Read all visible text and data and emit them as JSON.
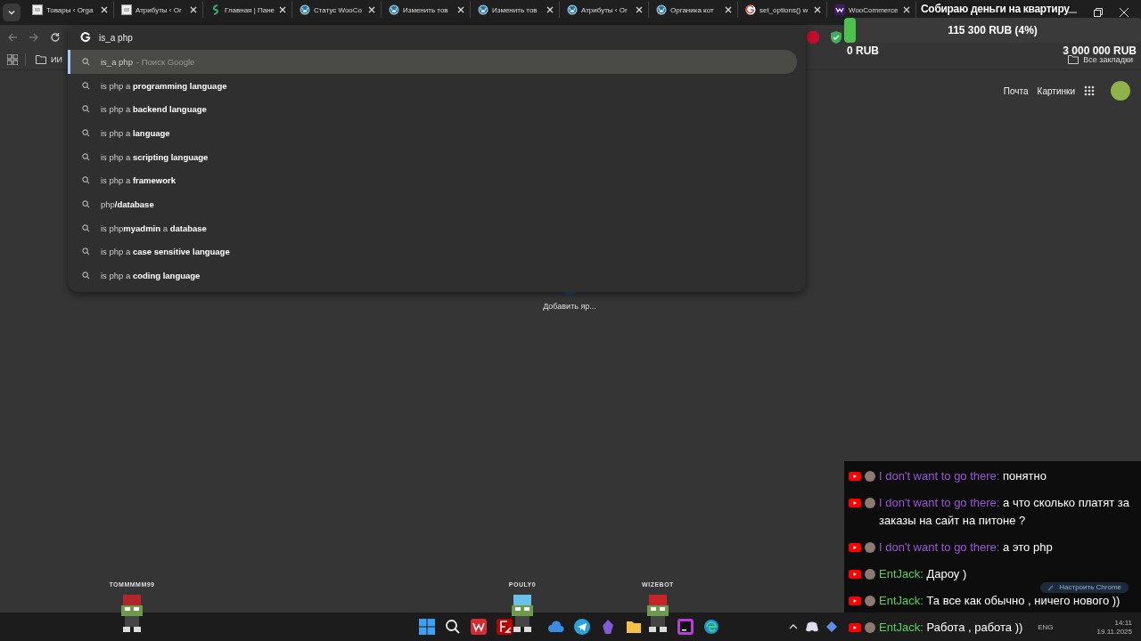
{
  "tabs": [
    {
      "title": "Товары ‹ Orga",
      "kind": "page",
      "selected": false
    },
    {
      "title": "Атрибуты ‹ Or",
      "kind": "page",
      "selected": false
    },
    {
      "title": "Главная | Пане",
      "kind": "sheet",
      "selected": false
    },
    {
      "title": "Статус WooCo",
      "kind": "wp",
      "selected": false
    },
    {
      "title": "Изменить тов",
      "kind": "wp",
      "selected": false
    },
    {
      "title": "Изменить тов",
      "kind": "wp",
      "selected": false
    },
    {
      "title": "Атрибуты ‹ Or",
      "kind": "wp",
      "selected": false
    },
    {
      "title": "Органика кот",
      "kind": "wp",
      "selected": false
    },
    {
      "title": "set_options() w",
      "kind": "google",
      "selected": false
    },
    {
      "title": "WooCommerce",
      "kind": "woo",
      "selected": false
    }
  ],
  "omnibox": {
    "value": "is_a php"
  },
  "bookmarks": [
    {
      "label": "ИИ"
    }
  ],
  "all_bookmarks": "Все закладки",
  "suggestions": [
    {
      "text": "is_a php",
      "suffix": "- Поиск Google",
      "selected": true
    },
    {
      "text": "is php a **programming language**",
      "selected": false
    },
    {
      "text": "is php a **backend language**",
      "selected": false
    },
    {
      "text": "is php a **language**",
      "selected": false
    },
    {
      "text": "is php a **scripting language**",
      "selected": false
    },
    {
      "text": "is php a **framework**",
      "selected": false
    },
    {
      "text": "php**/database**",
      "selected": false
    },
    {
      "text": "is php**myadmin** a **database**",
      "selected": false
    },
    {
      "text": "is php a **case sensitive language**",
      "selected": false
    },
    {
      "text": "is php a **coding language**",
      "selected": false
    }
  ],
  "google": {
    "links": [
      "Почта",
      "Картинки"
    ],
    "shortcut": "Добавить яр...",
    "customize": "Настроить Chrome"
  },
  "donation": {
    "title": "Собираю деньги на квартиру",
    "raised": "115 300 RUB (4%)",
    "level": 0.04,
    "min": "0 RUB",
    "max": "3 000 000 RUB"
  },
  "chat": [
    {
      "author": "I don't want to go there:",
      "color": "#9b55d9",
      "text": "понятно"
    },
    {
      "author": "I don't want to go there:",
      "color": "#9b55d9",
      "text": "а что сколько платят за заказы на сайт на питоне ?"
    },
    {
      "author": "I don't want to go there:",
      "color": "#9b55d9",
      "text": "а это php"
    },
    {
      "author": "EntJack:",
      "color": "#5ccf62",
      "text": "Дароу )"
    },
    {
      "author": "EntJack:",
      "color": "#5ccf62",
      "text": "Та все как обычно , ничего нового ))"
    },
    {
      "author": "EntJack:",
      "color": "#5ccf62",
      "text": "Работа , работа ))"
    }
  ],
  "viewers": [
    "TOMMMMM99",
    "POULY0",
    "WIZEBOT"
  ],
  "tray": {
    "language": "ENG",
    "time": "14:11",
    "date": "19.11.2025"
  }
}
